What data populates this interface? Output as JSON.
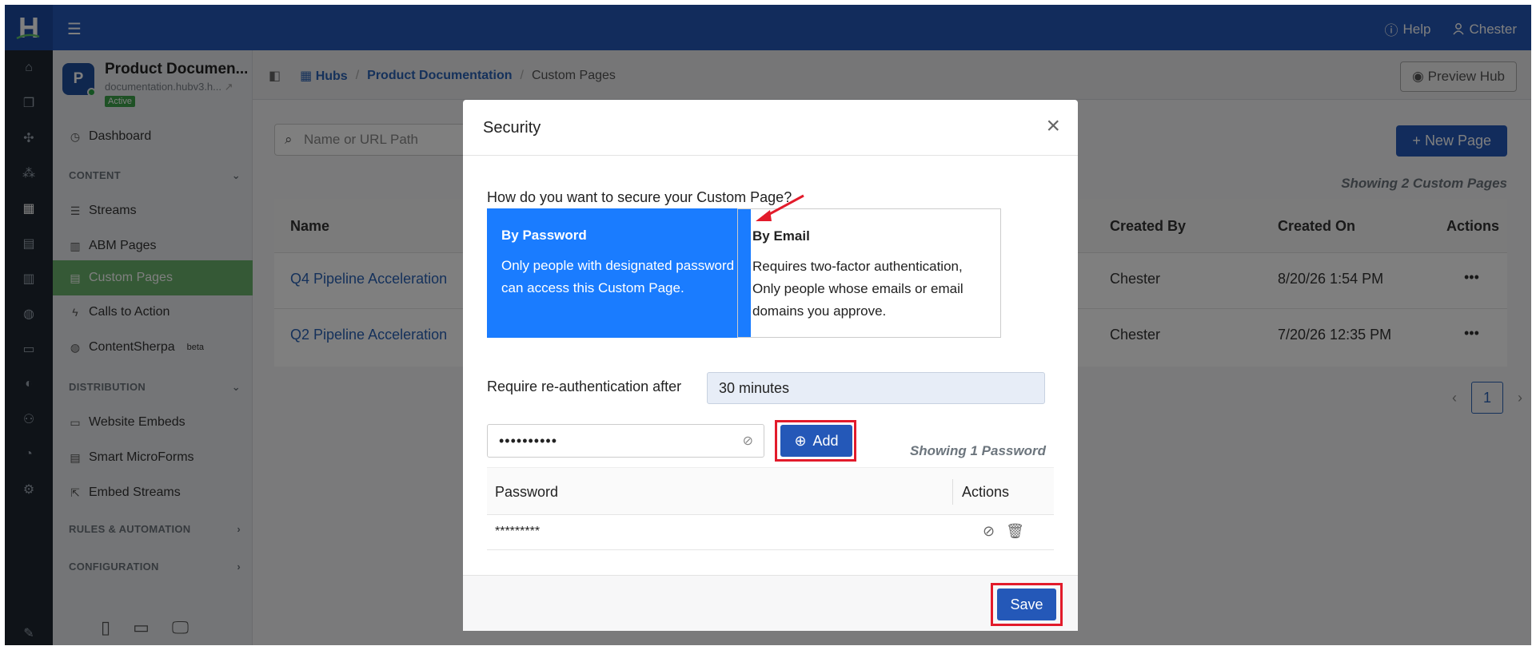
{
  "header": {
    "logo": "H",
    "help_label": "Help",
    "user_label": "Chester"
  },
  "hub": {
    "avatar": "P",
    "name": "Product Documen...",
    "url": "documentation.hubv3.h...",
    "status": "Active"
  },
  "sidebar": {
    "dashboard": "Dashboard",
    "content_header": "CONTENT",
    "content_items": [
      "Streams",
      "ABM Pages",
      "Custom Pages",
      "Calls to Action",
      "ContentSherpa"
    ],
    "beta": "beta",
    "distribution_header": "DISTRIBUTION",
    "distribution_items": [
      "Website Embeds",
      "Smart MicroForms",
      "Embed Streams"
    ],
    "rules_header": "RULES & AUTOMATION",
    "config_header": "CONFIGURATION"
  },
  "breadcrumb": {
    "hubs": "Hubs",
    "hub": "Product Documentation",
    "current": "Custom Pages"
  },
  "toolbar": {
    "preview": "Preview Hub",
    "search_placeholder": "Name or URL Path",
    "new_page": "New Page",
    "showing": "Showing 2 Custom Pages"
  },
  "table": {
    "columns": [
      "Name",
      "Created By",
      "Created On",
      "Actions"
    ],
    "rows": [
      {
        "name": "Q4 Pipeline Acceleration",
        "created_by": "Chester",
        "created_on": "8/20/26 1:54 PM",
        "actions": "•••"
      },
      {
        "name": "Q2 Pipeline Acceleration",
        "created_by": "Chester",
        "created_on": "7/20/26 12:35 PM",
        "actions": "•••"
      }
    ]
  },
  "pagination": {
    "page": "1"
  },
  "modal": {
    "title": "Security",
    "question": "How do you want to secure your Custom Page?",
    "option_password": {
      "title": "By Password",
      "desc": "Only people with designated password can access this Custom Page."
    },
    "option_email": {
      "title": "By Email",
      "desc": "Requires two-factor authentication, Only people whose emails or email domains you approve."
    },
    "reauth_label": "Require re-authentication after",
    "reauth_value": "30 minutes",
    "password_value": "••••••••••",
    "add_label": "Add",
    "showing": "Showing 1 Password",
    "pw_columns": [
      "Password",
      "Actions"
    ],
    "pw_rows": [
      {
        "password": "*********"
      }
    ],
    "save_label": "Save"
  },
  "colors": {
    "brand": "#2458b8",
    "selected_card": "#1a7cff",
    "active_nav": "#6bb36d",
    "highlight": "#e21b2b"
  }
}
